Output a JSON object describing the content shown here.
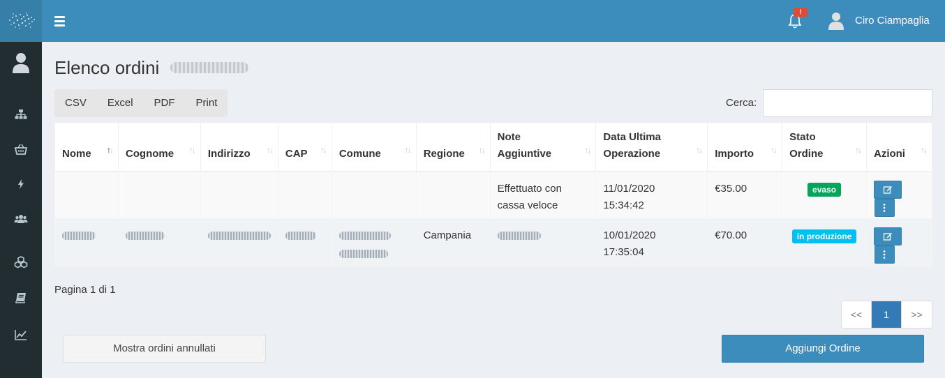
{
  "header": {
    "user_name": "Ciro Ciampaglia",
    "notification_badge": "!"
  },
  "sidebar": {
    "icons": [
      "sitemap-icon",
      "basket-icon",
      "bolt-icon",
      "users-icon",
      "cubes-icon",
      "book-icon",
      "chart-line-icon"
    ]
  },
  "page": {
    "title": "Elenco ordini"
  },
  "toolbar": {
    "buttons": [
      "CSV",
      "Excel",
      "PDF",
      "Print"
    ],
    "search_label": "Cerca:",
    "search_value": ""
  },
  "table": {
    "columns": [
      {
        "l1": "Nome",
        "l2": ""
      },
      {
        "l1": "Cognome",
        "l2": ""
      },
      {
        "l1": "Indirizzo",
        "l2": ""
      },
      {
        "l1": "CAP",
        "l2": ""
      },
      {
        "l1": "Comune",
        "l2": ""
      },
      {
        "l1": "Regione",
        "l2": ""
      },
      {
        "l1": "Note",
        "l2": "Aggiuntive"
      },
      {
        "l1": "Data Ultima",
        "l2": "Operazione"
      },
      {
        "l1": "Importo",
        "l2": ""
      },
      {
        "l1": "Stato",
        "l2": "Ordine"
      },
      {
        "l1": "Azioni",
        "l2": ""
      }
    ],
    "rows": [
      {
        "regione": "",
        "note_l1": "Effettuato con",
        "note_l2": "cassa veloce",
        "data_l1": "11/01/2020",
        "data_l2": "15:34:42",
        "importo": "€35.00",
        "stato": "evaso"
      },
      {
        "regione": "Campania",
        "note_l1": "",
        "note_l2": "",
        "data_l1": "10/01/2020",
        "data_l2": "17:35:04",
        "importo": "€70.00",
        "stato": "in produzione"
      }
    ]
  },
  "colors": {
    "primary": "#3c8dbc",
    "sidebar": "#222d32",
    "evaso": "#00a65a",
    "in_produzione": "#00c0ef"
  },
  "footer": {
    "page_info": "Pagina 1 di 1",
    "pager": [
      "<<",
      "1",
      ">>"
    ],
    "show_cancelled_label": "Mostra ordini annullati",
    "add_order_label": "Aggiungi Ordine"
  }
}
